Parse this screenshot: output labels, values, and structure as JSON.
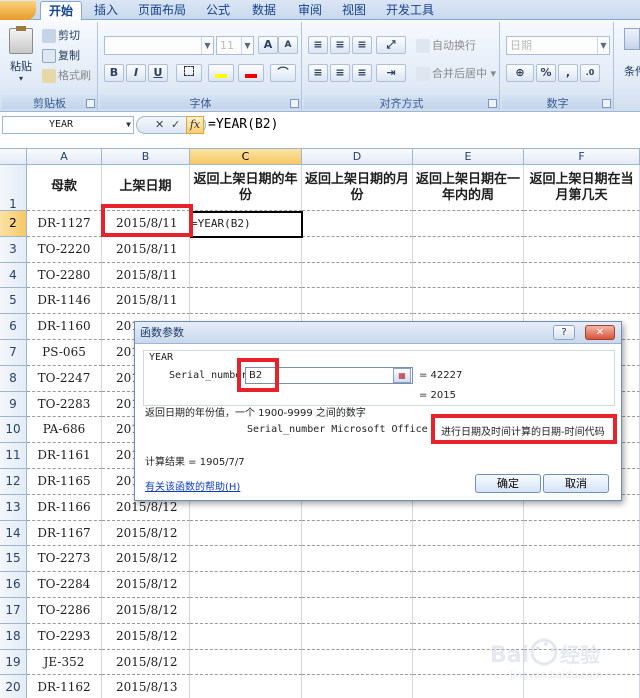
{
  "tabs": [
    "开始",
    "插入",
    "页面布局",
    "公式",
    "数据",
    "审阅",
    "视图",
    "开发工具"
  ],
  "ribbon": {
    "clipboard": {
      "label": "剪贴板",
      "paste": "粘贴",
      "cut": "剪切",
      "copy": "复制",
      "format_painter": "格式刷"
    },
    "font": {
      "label": "字体",
      "font_size": "11",
      "bold": "B",
      "italic": "I",
      "underline": "U",
      "grow": "A",
      "shrink": "A"
    },
    "alignment": {
      "label": "对齐方式",
      "wrap": "自动换行",
      "merge": "合并后居中"
    },
    "number": {
      "label": "数字",
      "format": "日期",
      "percent": "%"
    },
    "styles": {
      "label": "条件"
    }
  },
  "formula_bar": {
    "name_box": "YEAR",
    "cancel": "✕",
    "enter": "✓",
    "fx": "fx",
    "formula": "=YEAR(B2)"
  },
  "sheet": {
    "columns": [
      "A",
      "B",
      "C",
      "D",
      "E",
      "F"
    ],
    "headers": [
      "母款",
      "上架日期",
      "返回上架日期的年份",
      "返回上架日期的月份",
      "返回上架日期在一年内的周",
      "返回上架日期在当月第几天"
    ],
    "rows": [
      {
        "num": "1"
      },
      {
        "num": "2",
        "a": "DR-1127",
        "b": "2015/8/11",
        "c": "=YEAR(B2)"
      },
      {
        "num": "3",
        "a": "TO-2220",
        "b": "2015/8/11"
      },
      {
        "num": "4",
        "a": "TO-2280",
        "b": "2015/8/11"
      },
      {
        "num": "5",
        "a": "DR-1146",
        "b": "2015/8/11"
      },
      {
        "num": "6",
        "a": "DR-1160",
        "b": "201"
      },
      {
        "num": "7",
        "a": "PS-065",
        "b": "201"
      },
      {
        "num": "8",
        "a": "TO-2247",
        "b": "201"
      },
      {
        "num": "9",
        "a": "TO-2283",
        "b": "201"
      },
      {
        "num": "10",
        "a": "PA-686",
        "b": "201"
      },
      {
        "num": "11",
        "a": "DR-1161",
        "b": "201"
      },
      {
        "num": "12",
        "a": "DR-1165",
        "b": "201"
      },
      {
        "num": "13",
        "a": "DR-1166",
        "b": "2015/8/12"
      },
      {
        "num": "14",
        "a": "DR-1167",
        "b": "2015/8/12"
      },
      {
        "num": "15",
        "a": "TO-2273",
        "b": "2015/8/12"
      },
      {
        "num": "16",
        "a": "TO-2284",
        "b": "2015/8/12"
      },
      {
        "num": "17",
        "a": "TO-2286",
        "b": "2015/8/12"
      },
      {
        "num": "18",
        "a": "TO-2293",
        "b": "2015/8/12"
      },
      {
        "num": "19",
        "a": "JE-352",
        "b": "2015/8/12"
      },
      {
        "num": "20",
        "a": "DR-1162",
        "b": "2015/8/13"
      }
    ]
  },
  "dialog": {
    "title": "函数参数",
    "help_button": "?",
    "close_button": "✕",
    "function_name": "YEAR",
    "arg_label": "Serial_number",
    "arg_value": "B2",
    "arg_result": "= 42227",
    "func_result": "= 2015",
    "description": "返回日期的年份值，一个 1900-9999 之间的数字",
    "arg_desc_prefix": "Serial_number  Microsoft Office Exce",
    "arg_desc_highlight": "进行日期及时间计算的日期-时间代码",
    "calc_result": "计算结果 =  1905/7/7",
    "help_link": "有关该函数的帮助(H)",
    "ok": "确定",
    "cancel": "取消"
  },
  "watermark": {
    "text": "Bai  经验",
    "url": "jingyan.baidu.com"
  }
}
